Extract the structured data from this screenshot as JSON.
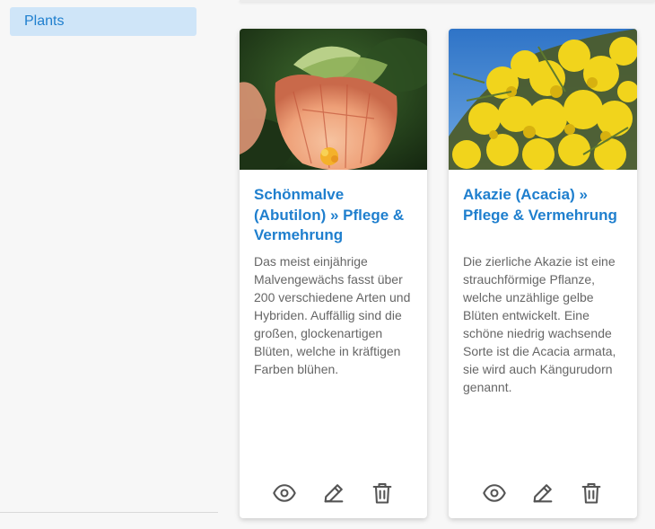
{
  "sidebar": {
    "items": [
      {
        "label": "Plants"
      }
    ]
  },
  "cards": [
    {
      "title": "Schönmalve (Abutilon) » Pflege & Vermehrung",
      "text": "Das meist einjährige Malvengewächs fasst über 200 verschiedene Arten und Hybriden. Auffällig sind die großen, glockenartigen Blüten, welche in kräftigen Farben blühen."
    },
    {
      "title": "Akazie (Acacia) » Pflege & Vermehrung",
      "text": "Die zierliche Akazie ist eine strauchförmige Pflanze, welche unzählige gelbe Blüten entwickelt. Eine schöne niedrig wachsende Sorte ist die Acacia armata, sie wird auch Kängurudorn genannt."
    }
  ],
  "icons": {
    "view": "eye-icon",
    "edit": "pencil-icon",
    "delete": "trash-icon"
  },
  "colors": {
    "accent": "#1f7fce",
    "nav_active_bg": "#cfe5f8",
    "icon": "#555555"
  }
}
